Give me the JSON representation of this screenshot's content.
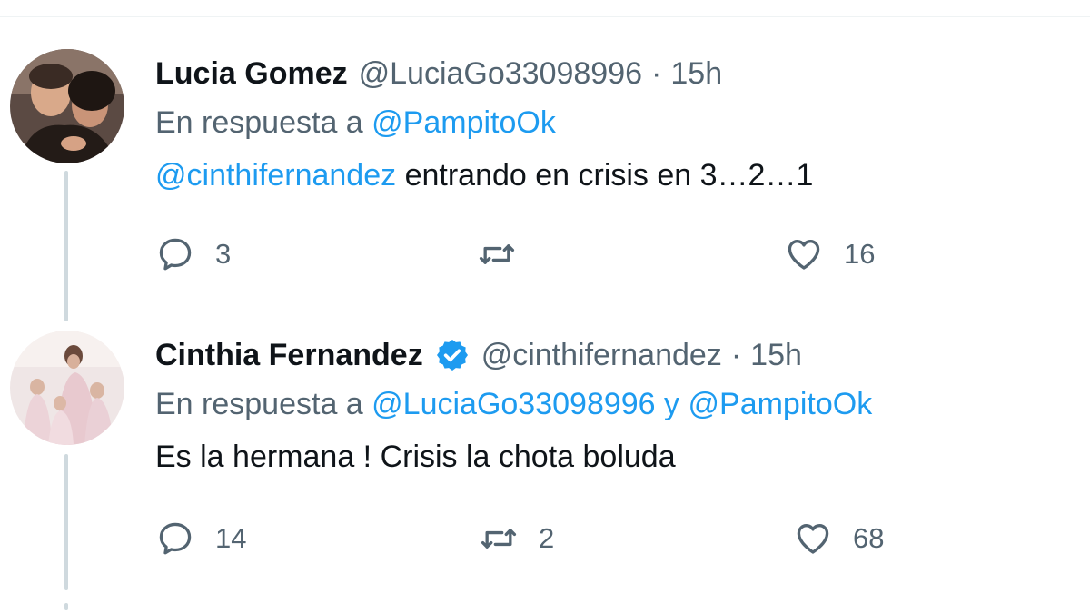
{
  "colors": {
    "accent": "#1d9bf0",
    "secondary_text": "#536471",
    "primary_text": "#0f1419",
    "thread_line": "#cfd9de"
  },
  "tweets": [
    {
      "display_name": "Lucia Gomez",
      "handle": "@LuciaGo33098996",
      "separator": "·",
      "time": "15h",
      "verified": false,
      "reply_prefix": "En respuesta a",
      "reply_mentions": [
        "@PampitoOk"
      ],
      "reply_joiner": "",
      "text_mention": "@cinthifernandez",
      "text": " entrando en crisis en 3…2…1",
      "reply_count": "3",
      "retweet_count": "",
      "like_count": "16"
    },
    {
      "display_name": "Cinthia Fernandez",
      "handle": "@cinthifernandez",
      "separator": "·",
      "time": "15h",
      "verified": true,
      "verified_icon": "verified-badge-icon",
      "reply_prefix": "En respuesta a",
      "reply_mentions": [
        "@LuciaGo33098996",
        "@PampitoOk"
      ],
      "reply_joiner": " y ",
      "text_mention": "",
      "text": "Es la hermana ! Crisis la chota boluda",
      "reply_count": "14",
      "retweet_count": "2",
      "like_count": "68"
    }
  ],
  "icons": {
    "reply": "reply-bubble-icon",
    "retweet": "retweet-arrows-icon",
    "like": "heart-icon"
  }
}
